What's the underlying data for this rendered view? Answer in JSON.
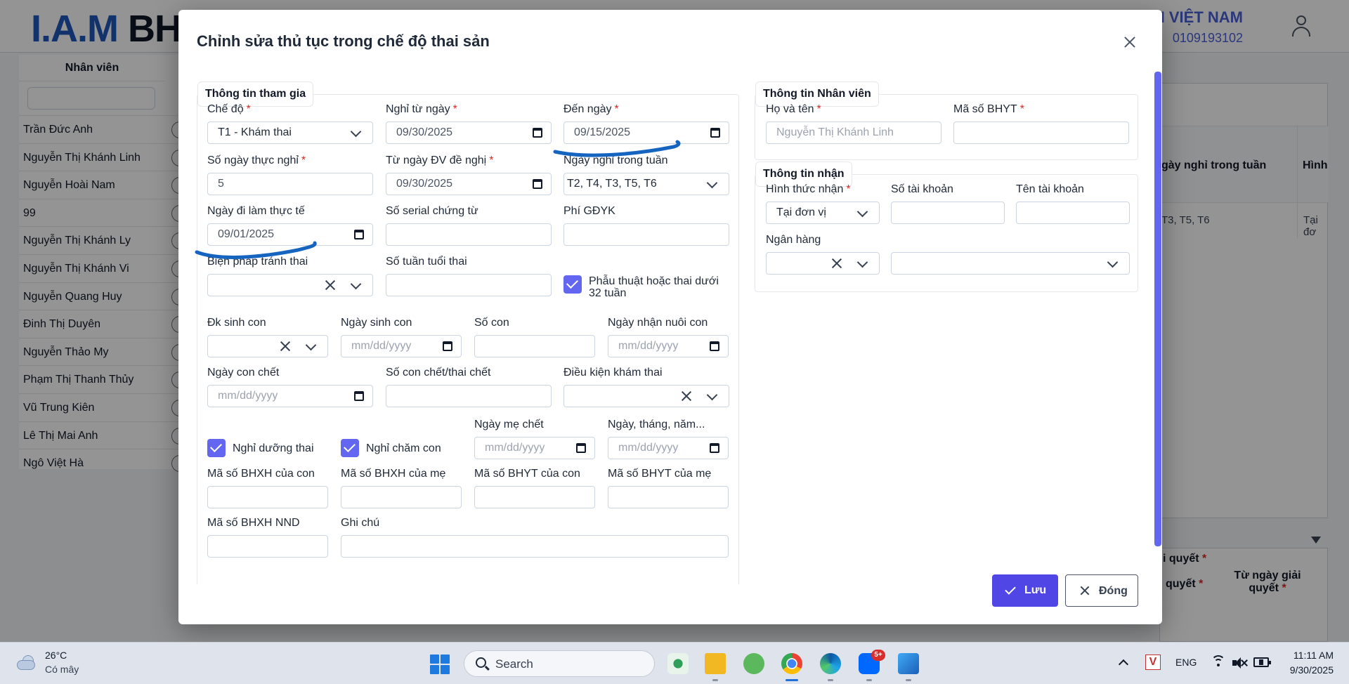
{
  "background": {
    "logo_part1": "I.A.M",
    "logo_part2": "BH",
    "company_name": "IAM VIỆT NAM",
    "company_code": "0109193102",
    "employee_header": "Nhân viên",
    "employees": [
      "Trần Đức Anh",
      "Nguyễn Thị Khánh Linh",
      "Nguyễn Hoài Nam",
      "99",
      "Nguyễn Thị Khánh Ly",
      "Nguyễn Thị Khánh Vi",
      "Nguyễn Quang Huy",
      "Đinh Thị Duyên",
      "Nguyễn Thảo My",
      "Phạm Thị Thanh Thủy",
      "Vũ Trung Kiên",
      "Lê Thị Mai Anh",
      "Ngô Việt Hà"
    ],
    "right_col1_header": "gày nghỉ trong tuần",
    "right_col2_header": "Hình",
    "right_col1_value": "T3, T5, T6",
    "right_col2_value": "Tại đơ",
    "right2_header_top": "i quyết",
    "right2_header_left": "quyết",
    "right2_header_right": "Từ ngày giải quyết",
    "required_mark": "*"
  },
  "modal": {
    "title": "Chỉnh sửa thủ tục trong chế độ thai sản",
    "sections": {
      "participation": "Thông tin tham gia",
      "employee": "Thông tin Nhân viên",
      "receive": "Thông tin nhận"
    },
    "fields": {
      "che_do": {
        "label": "Chế độ",
        "value": "T1 - Khám thai"
      },
      "nghi_tu_ngay": {
        "label": "Nghỉ từ ngày",
        "value": "09/30/2025"
      },
      "den_ngay": {
        "label": "Đến ngày",
        "value": "09/15/2025"
      },
      "so_ngay_thuc_nghi": {
        "label": "Số ngày thực nghỉ",
        "value": "5"
      },
      "tu_ngay_dv_de_nghi": {
        "label": "Từ ngày ĐV đề nghị",
        "value": "09/30/2025"
      },
      "ngay_nghi_trong_tuan": {
        "label": "Ngày nghỉ trong tuần",
        "value": "T2, T4, T3, T5, T6"
      },
      "ngay_di_lam_thuc_te": {
        "label": "Ngày đi làm thực tế",
        "value": "09/01/2025"
      },
      "so_serial_chung_tu": {
        "label": "Số serial chứng từ"
      },
      "phi_gdyk": {
        "label": "Phí GĐYK"
      },
      "bien_phap_tranh_thai": {
        "label": "Biện pháp tránh thai"
      },
      "so_tuan_tuoi_thai": {
        "label": "Số tuần tuổi thai"
      },
      "phau_thuat": {
        "label": "Phẫu thuật hoặc thai dưới 32 tuần"
      },
      "dk_sinh_con": {
        "label": "Đk sinh con"
      },
      "ngay_sinh_con": {
        "label": "Ngày sinh con",
        "placeholder": "mm/dd/yyyy"
      },
      "so_con": {
        "label": "Số con"
      },
      "ngay_nhan_nuoi_con": {
        "label": "Ngày nhận nuôi con",
        "placeholder": "mm/dd/yyyy"
      },
      "ngay_con_chet": {
        "label": "Ngày con chết",
        "placeholder": "mm/dd/yyyy"
      },
      "so_con_chet": {
        "label": "Số con chết/thai chết"
      },
      "dieu_kien_kham_thai": {
        "label": "Điều kiện khám thai"
      },
      "nghi_duong_thai": {
        "label": "Nghỉ dưỡng thai"
      },
      "nghi_cham_con": {
        "label": "Nghỉ chăm con"
      },
      "ngay_me_chet": {
        "label": "Ngày mẹ chết",
        "placeholder": "mm/dd/yyyy"
      },
      "ngay_thang_nam": {
        "label": "Ngày, tháng, năm...",
        "placeholder": "mm/dd/yyyy"
      },
      "ma_bhxh_con": {
        "label": "Mã số BHXH của con"
      },
      "ma_bhxh_me": {
        "label": "Mã số BHXH của mẹ"
      },
      "ma_bhyt_con": {
        "label": "Mã số BHYT của con"
      },
      "ma_bhyt_me": {
        "label": "Mã số BHYT của mẹ"
      },
      "ma_bhxh_nnd": {
        "label": "Mã số BHXH NND"
      },
      "ghi_chu": {
        "label": "Ghi chú"
      },
      "ho_va_ten": {
        "label": "Họ và tên",
        "placeholder": "Nguyễn Thị Khánh Linh"
      },
      "ma_so_bhyt": {
        "label": "Mã số BHYT"
      },
      "hinh_thuc_nhan": {
        "label": "Hình thức nhận",
        "value": "Tại đơn vị"
      },
      "so_tai_khoan": {
        "label": "Số tài khoản"
      },
      "ten_tai_khoan": {
        "label": "Tên tài khoản"
      },
      "ngan_hang": {
        "label": "Ngân hàng"
      }
    },
    "required_mark": "*",
    "save_label": "Lưu",
    "close_label": "Đóng",
    "annotation_color": "#1565c0",
    "accent_color": "#6366f1"
  },
  "taskbar": {
    "temperature": "26°C",
    "condition": "Có mây",
    "search_label": "Search",
    "badge": "5+",
    "tray_lang": "ENG",
    "tray_v": "V",
    "time": "11:11 AM",
    "date": "9/30/2025"
  }
}
